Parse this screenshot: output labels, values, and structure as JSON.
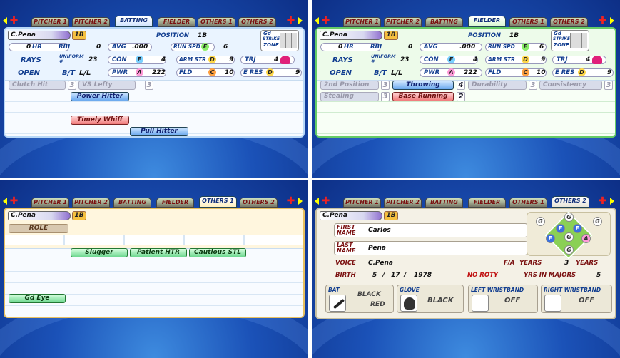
{
  "tabs": [
    "Pitcher 1",
    "Pitcher 2",
    "Batting",
    "Fielder",
    "Others 1",
    "Others 2"
  ],
  "player": {
    "name": "C.Pena",
    "position": "1B",
    "team": "RAYS",
    "uniform_label": "UNIFORM #",
    "uniform": "23",
    "bt_label": "B/T",
    "bt": "L/L",
    "status": "OPEN",
    "position_label": "POSITION",
    "position_value": "1B"
  },
  "stats": {
    "hr_label": "HR",
    "hr": "0",
    "rbi_label": "RBI",
    "rbi": "0",
    "avg_label": "AVG",
    "avg": ".000",
    "run_spd_label": "RUN SPD",
    "run_spd_grade": "E",
    "run_spd": "6",
    "con_label": "CON",
    "con_grade": "F",
    "con": "4",
    "arm_str_label": "ARM STR",
    "arm_str_grade": "D",
    "arm_str": "9",
    "trj_label": "TRJ",
    "trj": "4",
    "pwr_label": "PWR",
    "pwr_grade": "A",
    "pwr": "222",
    "fld_label": "FLD",
    "fld_grade": "C",
    "fld": "10",
    "e_res_label": "E RES",
    "e_res_grade": "D",
    "e_res": "9"
  },
  "zone": {
    "label_1": "Gd",
    "label_2": "STRIKE",
    "label_3": "ZONE"
  },
  "batting": {
    "clutch_label": "Clutch Hit",
    "clutch": "3",
    "vs_lefty_label": "VS Lefty",
    "vs_lefty": "3",
    "abilities": [
      "Power Hitter",
      "Timely Whiff",
      "Pull Hitter"
    ]
  },
  "fielder": {
    "rows": [
      {
        "label": "2nd Position",
        "value": "3"
      },
      {
        "label": "Throwing",
        "value": "4"
      },
      {
        "label": "Durability",
        "value": "3"
      },
      {
        "label": "Consistency",
        "value": "3"
      },
      {
        "label": "Stealing",
        "value": "3"
      },
      {
        "label": "Base Running",
        "value": "2"
      }
    ]
  },
  "others1": {
    "role_label": "ROLE",
    "abilities": [
      "Slugger",
      "Patient HTR",
      "Cautious STL",
      "Gd Eye"
    ]
  },
  "others2": {
    "first_name_label_1": "FIRST",
    "first_name_label_2": "NAME",
    "first_name": "Carlos",
    "last_name_label_1": "LAST",
    "last_name_label_2": "NAME",
    "last_name": "Pena",
    "voice_label": "VOICE",
    "voice": "C.Pena",
    "fa_label": "F/A",
    "years_label": "YEARS",
    "fa_years": "3",
    "birth_label": "BIRTH",
    "birth_month": "5",
    "birth_day": "17",
    "birth_year": "1978",
    "sep": "/",
    "roty": "NO ROTY",
    "yrs_majors_label": "YRS IN MAJORS",
    "yrs_majors": "5",
    "bat_label": "BAT",
    "bat_color_1": "BLACK",
    "bat_color_2": "RED",
    "glove_label": "GLOVE",
    "glove_color": "BLACK",
    "left_wb_label": "LEFT WRISTBAND",
    "left_wb": "OFF",
    "right_wb_label": "RIGHT WRISTBAND",
    "right_wb": "OFF"
  },
  "field_positions": [
    "G",
    "G",
    "G",
    "F",
    "F",
    "G",
    "A",
    "F",
    "G"
  ]
}
